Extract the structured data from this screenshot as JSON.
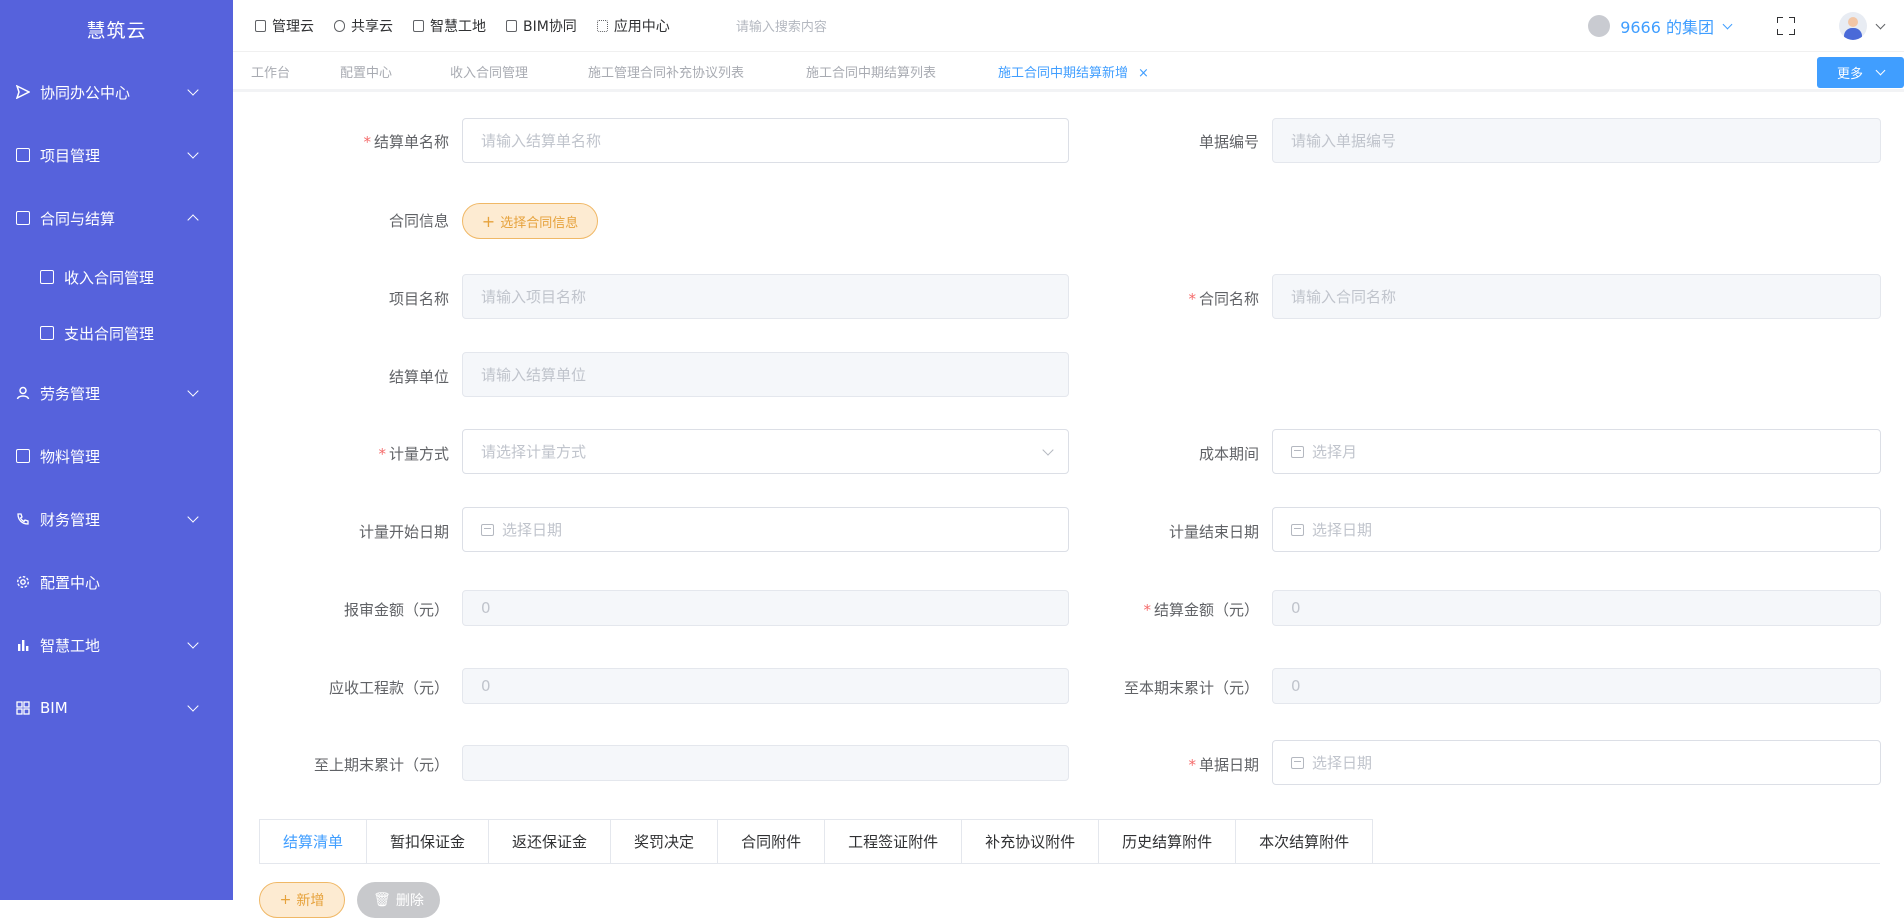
{
  "app": {
    "logo": "慧筑云"
  },
  "sidebar": {
    "items": [
      {
        "label": "协同办公中心"
      },
      {
        "label": "项目管理"
      },
      {
        "label": "合同与结算"
      },
      {
        "label": "收入合同管理"
      },
      {
        "label": "支出合同管理"
      },
      {
        "label": "劳务管理"
      },
      {
        "label": "物料管理"
      },
      {
        "label": "财务管理"
      },
      {
        "label": "配置中心"
      },
      {
        "label": "智慧工地"
      },
      {
        "label": "BIM"
      }
    ]
  },
  "topbar": {
    "links": [
      "管理云",
      "共享云",
      "智慧工地",
      "BIM协同",
      "应用中心"
    ],
    "search_placeholder": "请输入搜索内容",
    "group": "9666 的集团"
  },
  "tabs": {
    "items": [
      "工作台",
      "配置中心",
      "收入合同管理",
      "施工管理合同补充协议列表",
      "施工合同中期结算列表",
      "施工合同中期结算新增"
    ],
    "close": "×",
    "more": "更多"
  },
  "form": {
    "settle_name_label": "结算单名称",
    "settle_name_ph": "请输入结算单名称",
    "doc_no_label": "单据编号",
    "doc_no_ph": "请输入单据编号",
    "contract_info_label": "合同信息",
    "choose_contract": "选择合同信息",
    "project_name_label": "项目名称",
    "project_name_ph": "请输入项目名称",
    "contract_name_label": "合同名称",
    "contract_name_ph": "请输入合同名称",
    "settle_unit_label": "结算单位",
    "settle_unit_ph": "请输入结算单位",
    "measure_method_label": "计量方式",
    "measure_method_ph": "请选择计量方式",
    "cost_period_label": "成本期间",
    "cost_period_ph": "选择月",
    "measure_start_label": "计量开始日期",
    "measure_start_ph": "选择日期",
    "measure_end_label": "计量结束日期",
    "measure_end_ph": "选择日期",
    "report_amount_label": "报审金额（元）",
    "report_amount_val": "0",
    "settle_amount_label": "结算金额（元）",
    "settle_amount_val": "0",
    "receivable_label": "应收工程款（元）",
    "receivable_val": "0",
    "cum_current_label": "至本期末累计（元）",
    "cum_current_val": "0",
    "cum_prev_label": "至上期末累计（元）",
    "doc_date_label": "单据日期",
    "doc_date_ph": "选择日期",
    "required_mark": "*"
  },
  "bottom_tabs": [
    "结算清单",
    "暂扣保证金",
    "返还保证金",
    "奖罚决定",
    "合同附件",
    "工程签证附件",
    "补充协议附件",
    "历史结算附件",
    "本次结算附件"
  ],
  "actions": {
    "add": "新增",
    "delete": "删除"
  },
  "colors": {
    "sidebar": "#5662dc",
    "primary": "#409eff",
    "warning": "#e6a23c",
    "danger": "#f56c6c"
  }
}
